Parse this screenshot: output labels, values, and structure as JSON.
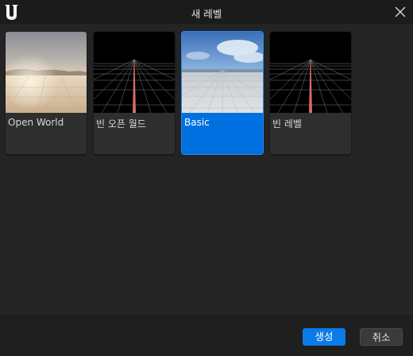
{
  "window": {
    "title": "새 레벨",
    "logo_icon": "unreal-engine-logo",
    "close_icon": "close-icon"
  },
  "templates": [
    {
      "label": "Open World",
      "thumbnail": "open-world-sky-thumbnail",
      "selected": false
    },
    {
      "label": "빈 오픈 월드",
      "thumbnail": "empty-grid-thumbnail",
      "selected": false
    },
    {
      "label": "Basic",
      "thumbnail": "basic-level-thumbnail",
      "selected": true
    },
    {
      "label": "빈 레벨",
      "thumbnail": "empty-grid-thumbnail",
      "selected": false
    }
  ],
  "footer": {
    "create_label": "생성",
    "cancel_label": "취소"
  },
  "colors": {
    "accent": "#0070e0",
    "background": "#242424",
    "tile": "#2e2e2e"
  }
}
